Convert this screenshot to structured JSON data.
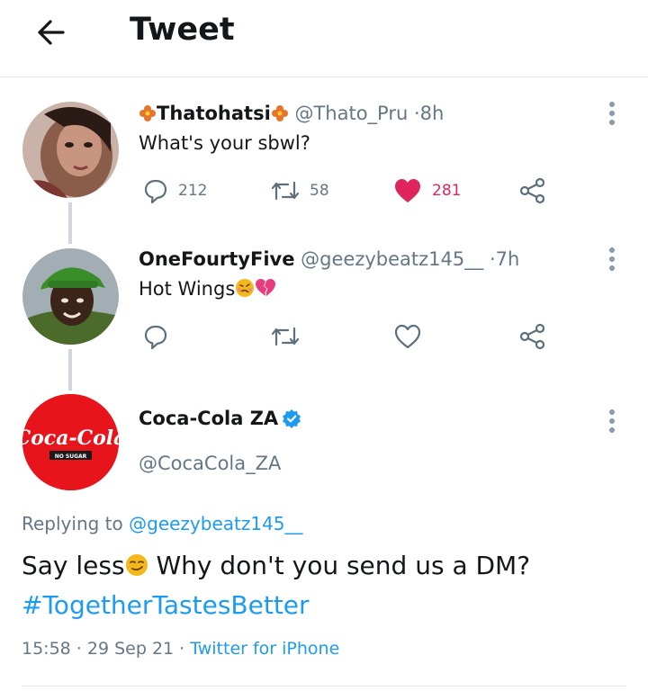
{
  "header": {
    "title": "Tweet"
  },
  "tweets": [
    {
      "display_name": "Thatohatsi",
      "handle": "@Thato_Pru",
      "time": "8h",
      "text": "What's your sbwl?",
      "replies": "212",
      "retweets": "58",
      "likes": "281"
    },
    {
      "display_name": "OneFourtyFive",
      "handle": "@geezybeatz145__",
      "time": "7h",
      "text": "Hot Wings"
    }
  ],
  "main": {
    "display_name": "Coca-Cola ZA",
    "handle": "@CocaCola_ZA",
    "avatar_logo": "Coca-Cola",
    "avatar_sub": "NO SUGAR",
    "replying_prefix": "Replying to",
    "replying_to": "@geezybeatz145__",
    "text_part1": "Say less",
    "text_part2": " Why don't you send us a DM?",
    "hashtag": "#TogetherTastesBetter",
    "timestamp": "15:58 · 29 Sep 21",
    "source": "Twitter for iPhone"
  },
  "separator": "·",
  "colors": {
    "like": "#e0245e",
    "link": "#1d9bf0",
    "muted": "#657786",
    "coke_red": "#e8141b"
  }
}
